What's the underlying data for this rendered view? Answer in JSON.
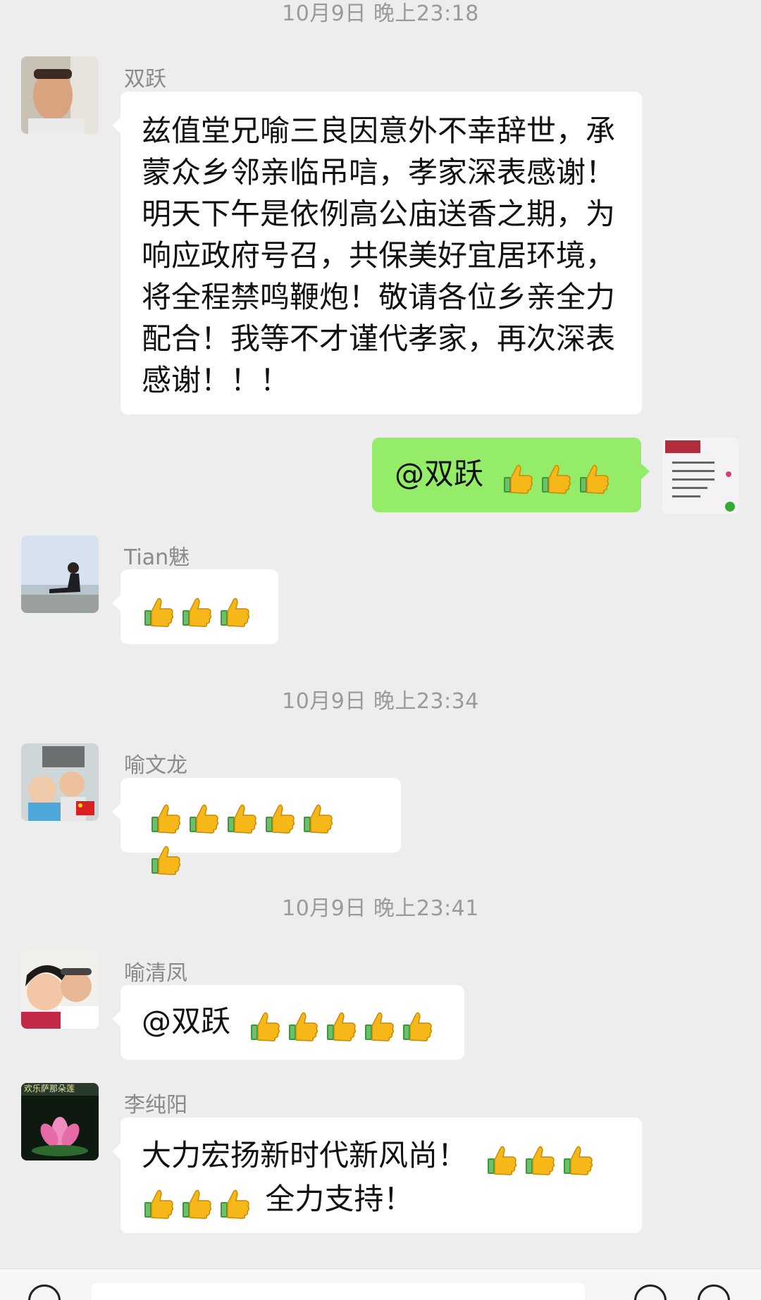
{
  "timestamps": [
    "10月9日 晚上23:18",
    "10月9日 晚上23:34",
    "10月9日 晚上23:41"
  ],
  "messages": [
    {
      "sender": "双跃",
      "text": "兹值堂兄喻三良因意外不幸辞世，承蒙众乡邻亲临吊唁，孝家深表感谢！明天下午是依例高公庙送香之期，为响应政府号召，共保美好宜居环境，将全程禁鸣鞭炮！敬请各位乡亲全力配合！我等不才谨代孝家，再次深表感谢！！！"
    },
    {
      "sender": "",
      "text": "@双跃",
      "thumbs": 3,
      "mine": true
    },
    {
      "sender": "Tian魅",
      "text": "",
      "thumbs": 3
    },
    {
      "sender": "喻文龙",
      "text": "",
      "thumbs": 6
    },
    {
      "sender": "喻清凤",
      "text": "@双跃",
      "thumbs": 5
    },
    {
      "sender": "李纯阳",
      "text_line1": "大力宏扬新时代新风尚！",
      "text_line2": "全力支持！",
      "thumbs_line1": 3,
      "thumbs_line2": 3
    }
  ],
  "icons": {
    "thumbs_up": "thumbs-up-emoji",
    "avatar_6_text": "欢乐萨那朵莲"
  },
  "colors": {
    "background": "#ededed",
    "bubble_other": "#ffffff",
    "bubble_mine": "#95ec69",
    "timestamp": "#9a9a9a",
    "sender": "#8a8a8a"
  }
}
